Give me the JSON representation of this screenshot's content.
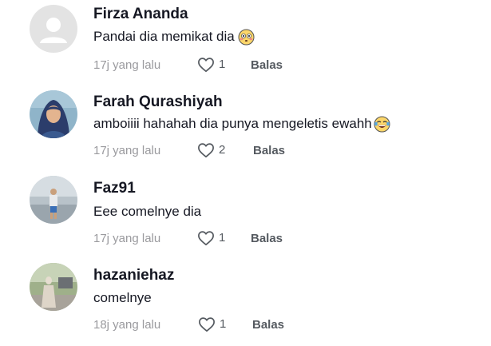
{
  "comments": [
    {
      "username": "Firza Ananda",
      "text": "Pandai dia memikat dia",
      "emoji": "flushed-face-emoji",
      "time": "17j yang lalu",
      "likes": "1",
      "reply_label": "Balas",
      "avatar": "default-avatar"
    },
    {
      "username": "Farah Qurashiyah",
      "text": "amboiiii hahahah dia punya mengeletis ewahh",
      "emoji": "tears-of-joy-emoji",
      "time": "17j yang lalu",
      "likes": "2",
      "reply_label": "Balas",
      "avatar": "photo-avatar"
    },
    {
      "username": "Faz91",
      "text": "Eee comelnye dia",
      "time": "17j yang lalu",
      "likes": "1",
      "reply_label": "Balas",
      "avatar": "photo-avatar"
    },
    {
      "username": "hazaniehaz",
      "text": "comelnye",
      "time": "18j yang lalu",
      "likes": "1",
      "reply_label": "Balas",
      "avatar": "photo-avatar"
    }
  ],
  "icons": {
    "like": "heart-outline-icon"
  },
  "colors": {
    "text_primary": "#161823",
    "text_secondary": "#9a9a9e",
    "action": "#555a60"
  }
}
